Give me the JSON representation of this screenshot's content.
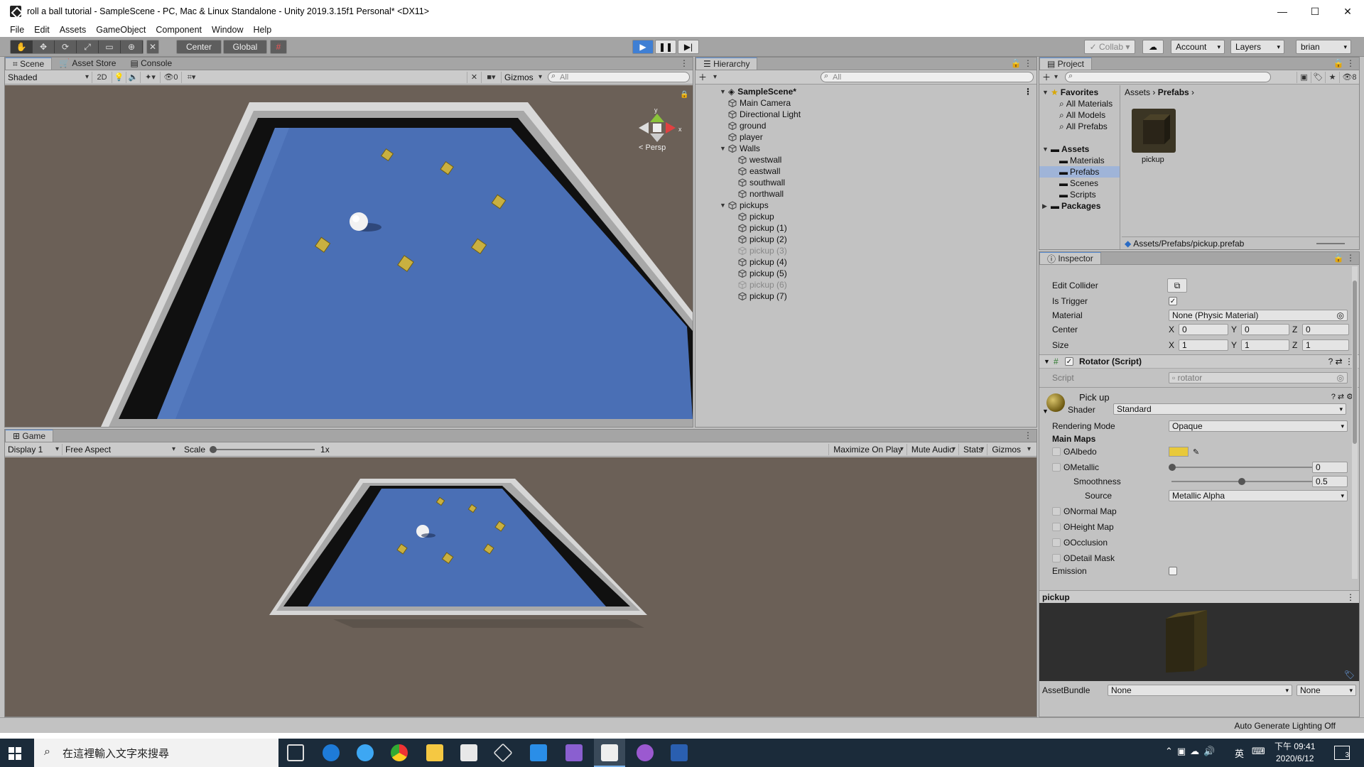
{
  "window": {
    "title": "roll a ball tutorial - SampleScene - PC, Mac & Linux Standalone - Unity 2019.3.15f1 Personal* <DX11>",
    "minimize": "—",
    "maximize": "☐",
    "close": "✕"
  },
  "menu": [
    "File",
    "Edit",
    "Assets",
    "GameObject",
    "Component",
    "Window",
    "Help"
  ],
  "toolbar": {
    "center": "Center",
    "global": "Global",
    "collab": "Collab",
    "account": "Account",
    "layers": "Layers",
    "user": "brian",
    "play_icon": "play-icon",
    "pause_icon": "pause-icon",
    "step_icon": "step-icon"
  },
  "scene": {
    "tabs": [
      "Scene",
      "Asset Store",
      "Console"
    ],
    "shading": "Shaded",
    "mode2d": "2D",
    "hidden_count": "0",
    "gizmos": "Gizmos",
    "search": "All",
    "persp": "< Persp"
  },
  "hierarchy": {
    "tab": "Hierarchy",
    "search": "All",
    "scene": "SampleScene*",
    "items": [
      {
        "name": "Main Camera",
        "indent": 1,
        "dim": false
      },
      {
        "name": "Directional Light",
        "indent": 1,
        "dim": false
      },
      {
        "name": "ground",
        "indent": 1,
        "dim": false
      },
      {
        "name": "player",
        "indent": 1,
        "dim": false
      },
      {
        "name": "Walls",
        "indent": 1,
        "dim": false,
        "expanded": true
      },
      {
        "name": "westwall",
        "indent": 2,
        "dim": false
      },
      {
        "name": "eastwall",
        "indent": 2,
        "dim": false
      },
      {
        "name": "southwall",
        "indent": 2,
        "dim": false
      },
      {
        "name": "northwall",
        "indent": 2,
        "dim": false
      },
      {
        "name": "pickups",
        "indent": 1,
        "dim": false,
        "expanded": true
      },
      {
        "name": "pickup",
        "indent": 2,
        "dim": false
      },
      {
        "name": "pickup (1)",
        "indent": 2,
        "dim": false
      },
      {
        "name": "pickup (2)",
        "indent": 2,
        "dim": false
      },
      {
        "name": "pickup (3)",
        "indent": 2,
        "dim": true
      },
      {
        "name": "pickup (4)",
        "indent": 2,
        "dim": false
      },
      {
        "name": "pickup (5)",
        "indent": 2,
        "dim": false
      },
      {
        "name": "pickup (6)",
        "indent": 2,
        "dim": true
      },
      {
        "name": "pickup (7)",
        "indent": 2,
        "dim": false
      }
    ]
  },
  "project": {
    "tab": "Project",
    "hidden_count": "8",
    "favorites": "Favorites",
    "fav_items": [
      "All Materials",
      "All Models",
      "All Prefabs"
    ],
    "assets": "Assets",
    "asset_items": [
      "Materials",
      "Prefabs",
      "Scenes",
      "Scripts"
    ],
    "packages": "Packages",
    "breadcrumb": [
      "Assets",
      "Prefabs"
    ],
    "asset_name": "pickup",
    "path": "Assets/Prefabs/pickup.prefab"
  },
  "inspector": {
    "tab": "Inspector",
    "edit_collider": "Edit Collider",
    "is_trigger": "Is Trigger",
    "material": "Material",
    "material_value": "None (Physic Material)",
    "center": "Center",
    "center_xyz": [
      "0",
      "0",
      "0"
    ],
    "size": "Size",
    "size_xyz": [
      "1",
      "1",
      "1"
    ],
    "rotator": "Rotator (Script)",
    "script": "Script",
    "script_value": "rotator",
    "mat_name": "Pick up",
    "shader": "Shader",
    "shader_value": "Standard",
    "rendering_mode": "Rendering Mode",
    "rendering_value": "Opaque",
    "main_maps": "Main Maps",
    "albedo": "Albedo",
    "albedo_color": "#e8c93a",
    "metallic": "Metallic",
    "metallic_value": "0",
    "smoothness": "Smoothness",
    "smoothness_value": "0.5",
    "source": "Source",
    "source_value": "Metallic Alpha",
    "normal_map": "Normal Map",
    "height_map": "Height Map",
    "occlusion": "Occlusion",
    "detail_mask": "Detail Mask",
    "emission": "Emission",
    "preview_title": "pickup",
    "assetbundle": "AssetBundle",
    "ab_value": "None",
    "ab_variant": "None"
  },
  "game": {
    "tab": "Game",
    "display": "Display 1",
    "aspect": "Free Aspect",
    "scale": "Scale",
    "scale_value": "1x",
    "maximize": "Maximize On Play",
    "mute": "Mute Audio",
    "stats": "Stats",
    "gizmos": "Gizmos"
  },
  "status": {
    "lighting": "Auto Generate Lighting Off"
  },
  "taskbar": {
    "search": "在這裡輸入文字來搜尋",
    "ime": "英",
    "time": "下午 09:41",
    "date": "2020/6/12",
    "notif": "3"
  }
}
